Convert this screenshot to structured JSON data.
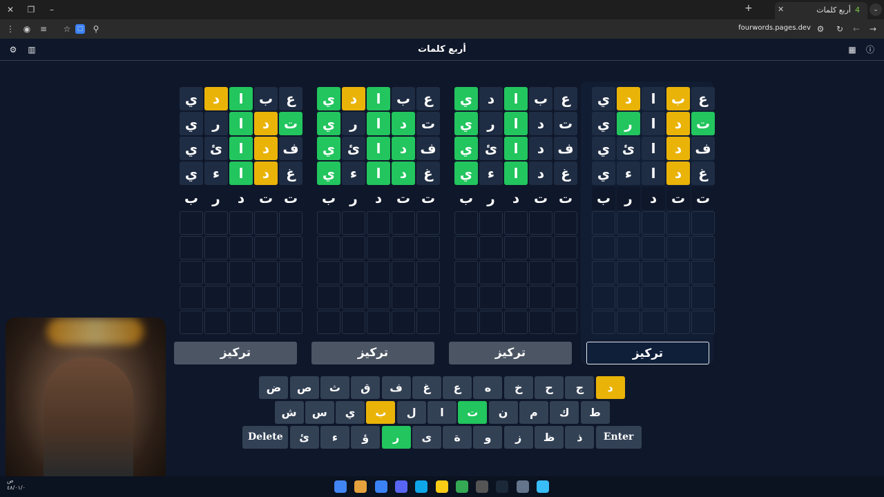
{
  "browser": {
    "tab_title": "أربع كلمات",
    "tab_favicon": "4",
    "url": "fourwords.pages.dev"
  },
  "header": {
    "title": "أربع كلمات"
  },
  "boards": [
    {
      "focus_label": "تركيز",
      "active": false,
      "rows": [
        [
          {
            "l": "ي",
            "s": "dark"
          },
          {
            "l": "د",
            "s": "yellow"
          },
          {
            "l": "ا",
            "s": "green"
          },
          {
            "l": "ب",
            "s": "dark"
          },
          {
            "l": "ع",
            "s": "dark"
          }
        ],
        [
          {
            "l": "ي",
            "s": "dark"
          },
          {
            "l": "ر",
            "s": "dark"
          },
          {
            "l": "ا",
            "s": "green"
          },
          {
            "l": "د",
            "s": "yellow"
          },
          {
            "l": "ت",
            "s": "green"
          }
        ],
        [
          {
            "l": "ي",
            "s": "dark"
          },
          {
            "l": "ئ",
            "s": "dark"
          },
          {
            "l": "ا",
            "s": "green"
          },
          {
            "l": "د",
            "s": "yellow"
          },
          {
            "l": "ف",
            "s": "dark"
          }
        ],
        [
          {
            "l": "ي",
            "s": "dark"
          },
          {
            "l": "ء",
            "s": "dark"
          },
          {
            "l": "ا",
            "s": "green"
          },
          {
            "l": "د",
            "s": "yellow"
          },
          {
            "l": "غ",
            "s": "dark"
          }
        ],
        [
          {
            "l": "ب",
            "s": "typed"
          },
          {
            "l": "ر",
            "s": "typed"
          },
          {
            "l": "د",
            "s": "typed"
          },
          {
            "l": "ت",
            "s": "typed"
          },
          {
            "l": "ت",
            "s": "typed"
          }
        ]
      ]
    },
    {
      "focus_label": "تركيز",
      "active": false,
      "rows": [
        [
          {
            "l": "ي",
            "s": "green"
          },
          {
            "l": "د",
            "s": "yellow"
          },
          {
            "l": "ا",
            "s": "green"
          },
          {
            "l": "ب",
            "s": "dark"
          },
          {
            "l": "ع",
            "s": "dark"
          }
        ],
        [
          {
            "l": "ي",
            "s": "green"
          },
          {
            "l": "ر",
            "s": "dark"
          },
          {
            "l": "ا",
            "s": "green"
          },
          {
            "l": "د",
            "s": "green"
          },
          {
            "l": "ت",
            "s": "dark"
          }
        ],
        [
          {
            "l": "ي",
            "s": "green"
          },
          {
            "l": "ئ",
            "s": "dark"
          },
          {
            "l": "ا",
            "s": "green"
          },
          {
            "l": "د",
            "s": "green"
          },
          {
            "l": "ف",
            "s": "dark"
          }
        ],
        [
          {
            "l": "ي",
            "s": "green"
          },
          {
            "l": "ء",
            "s": "dark"
          },
          {
            "l": "ا",
            "s": "green"
          },
          {
            "l": "د",
            "s": "green"
          },
          {
            "l": "غ",
            "s": "dark"
          }
        ],
        [
          {
            "l": "ب",
            "s": "typed"
          },
          {
            "l": "ر",
            "s": "typed"
          },
          {
            "l": "د",
            "s": "typed"
          },
          {
            "l": "ت",
            "s": "typed"
          },
          {
            "l": "ت",
            "s": "typed"
          }
        ]
      ]
    },
    {
      "focus_label": "تركيز",
      "active": false,
      "rows": [
        [
          {
            "l": "ي",
            "s": "green"
          },
          {
            "l": "د",
            "s": "dark"
          },
          {
            "l": "ا",
            "s": "green"
          },
          {
            "l": "ب",
            "s": "dark"
          },
          {
            "l": "ع",
            "s": "dark"
          }
        ],
        [
          {
            "l": "ي",
            "s": "green"
          },
          {
            "l": "ر",
            "s": "dark"
          },
          {
            "l": "ا",
            "s": "green"
          },
          {
            "l": "د",
            "s": "dark"
          },
          {
            "l": "ت",
            "s": "dark"
          }
        ],
        [
          {
            "l": "ي",
            "s": "green"
          },
          {
            "l": "ئ",
            "s": "dark"
          },
          {
            "l": "ا",
            "s": "green"
          },
          {
            "l": "د",
            "s": "dark"
          },
          {
            "l": "ف",
            "s": "dark"
          }
        ],
        [
          {
            "l": "ي",
            "s": "green"
          },
          {
            "l": "ء",
            "s": "dark"
          },
          {
            "l": "ا",
            "s": "green"
          },
          {
            "l": "د",
            "s": "dark"
          },
          {
            "l": "غ",
            "s": "dark"
          }
        ],
        [
          {
            "l": "ب",
            "s": "typed"
          },
          {
            "l": "ر",
            "s": "typed"
          },
          {
            "l": "د",
            "s": "typed"
          },
          {
            "l": "ت",
            "s": "typed"
          },
          {
            "l": "ت",
            "s": "typed"
          }
        ]
      ]
    },
    {
      "focus_label": "تركيز",
      "active": true,
      "rows": [
        [
          {
            "l": "ي",
            "s": "dark"
          },
          {
            "l": "د",
            "s": "yellow"
          },
          {
            "l": "ا",
            "s": "dark"
          },
          {
            "l": "ب",
            "s": "yellow"
          },
          {
            "l": "ع",
            "s": "dark"
          }
        ],
        [
          {
            "l": "ي",
            "s": "dark"
          },
          {
            "l": "ر",
            "s": "green"
          },
          {
            "l": "ا",
            "s": "dark"
          },
          {
            "l": "د",
            "s": "yellow"
          },
          {
            "l": "ت",
            "s": "green"
          }
        ],
        [
          {
            "l": "ي",
            "s": "dark"
          },
          {
            "l": "ئ",
            "s": "dark"
          },
          {
            "l": "ا",
            "s": "dark"
          },
          {
            "l": "د",
            "s": "yellow"
          },
          {
            "l": "ف",
            "s": "dark"
          }
        ],
        [
          {
            "l": "ي",
            "s": "dark"
          },
          {
            "l": "ء",
            "s": "dark"
          },
          {
            "l": "ا",
            "s": "dark"
          },
          {
            "l": "د",
            "s": "yellow"
          },
          {
            "l": "غ",
            "s": "dark"
          }
        ],
        [
          {
            "l": "ب",
            "s": "typed"
          },
          {
            "l": "ر",
            "s": "typed"
          },
          {
            "l": "د",
            "s": "typed"
          },
          {
            "l": "ت",
            "s": "typed"
          },
          {
            "l": "ت",
            "s": "typed"
          }
        ]
      ]
    }
  ],
  "empty_rows": 5,
  "keyboard": {
    "row1": [
      {
        "l": "ض",
        "s": "dark"
      },
      {
        "l": "ص",
        "s": "dark"
      },
      {
        "l": "ث",
        "s": "dark"
      },
      {
        "l": "ق",
        "s": "dark"
      },
      {
        "l": "ف",
        "s": "dark"
      },
      {
        "l": "غ",
        "s": "dark"
      },
      {
        "l": "ع",
        "s": "dark"
      },
      {
        "l": "ه",
        "s": "dark"
      },
      {
        "l": "خ",
        "s": "dark"
      },
      {
        "l": "ح",
        "s": "dark"
      },
      {
        "l": "ج",
        "s": "dark"
      },
      {
        "l": "د",
        "s": "yellow"
      }
    ],
    "row2": [
      {
        "l": "ش",
        "s": "dark"
      },
      {
        "l": "س",
        "s": "dark"
      },
      {
        "l": "ي",
        "s": "dark"
      },
      {
        "l": "ب",
        "s": "yellow"
      },
      {
        "l": "ل",
        "s": "dark"
      },
      {
        "l": "ا",
        "s": "dark"
      },
      {
        "l": "ت",
        "s": "green"
      },
      {
        "l": "ن",
        "s": "dark"
      },
      {
        "l": "م",
        "s": "dark"
      },
      {
        "l": "ك",
        "s": "dark"
      },
      {
        "l": "ط",
        "s": "dark"
      }
    ],
    "row3": [
      {
        "l": "Delete",
        "s": "dark",
        "wide": true
      },
      {
        "l": "ئ",
        "s": "dark"
      },
      {
        "l": "ء",
        "s": "dark"
      },
      {
        "l": "ؤ",
        "s": "dark"
      },
      {
        "l": "ر",
        "s": "green"
      },
      {
        "l": "ى",
        "s": "dark"
      },
      {
        "l": "ة",
        "s": "dark"
      },
      {
        "l": "و",
        "s": "dark"
      },
      {
        "l": "ز",
        "s": "dark"
      },
      {
        "l": "ظ",
        "s": "dark"
      },
      {
        "l": "ذ",
        "s": "dark"
      },
      {
        "l": "Enter",
        "s": "dark",
        "wide": true
      }
    ]
  },
  "colors": {
    "green": "#22c55e",
    "yellow": "#eab308",
    "background": "#0f172a",
    "key": "#334155"
  },
  "taskbar_icons": [
    "chrome-icon",
    "r-app-icon",
    "discord-alt-icon",
    "discord-icon",
    "edge-icon",
    "folder-icon",
    "chrome-2-icon",
    "obs-icon",
    "steam-icon",
    "settings-icon",
    "windows-icon"
  ],
  "tray_time": "ص\n٤٨/٠١/٠"
}
